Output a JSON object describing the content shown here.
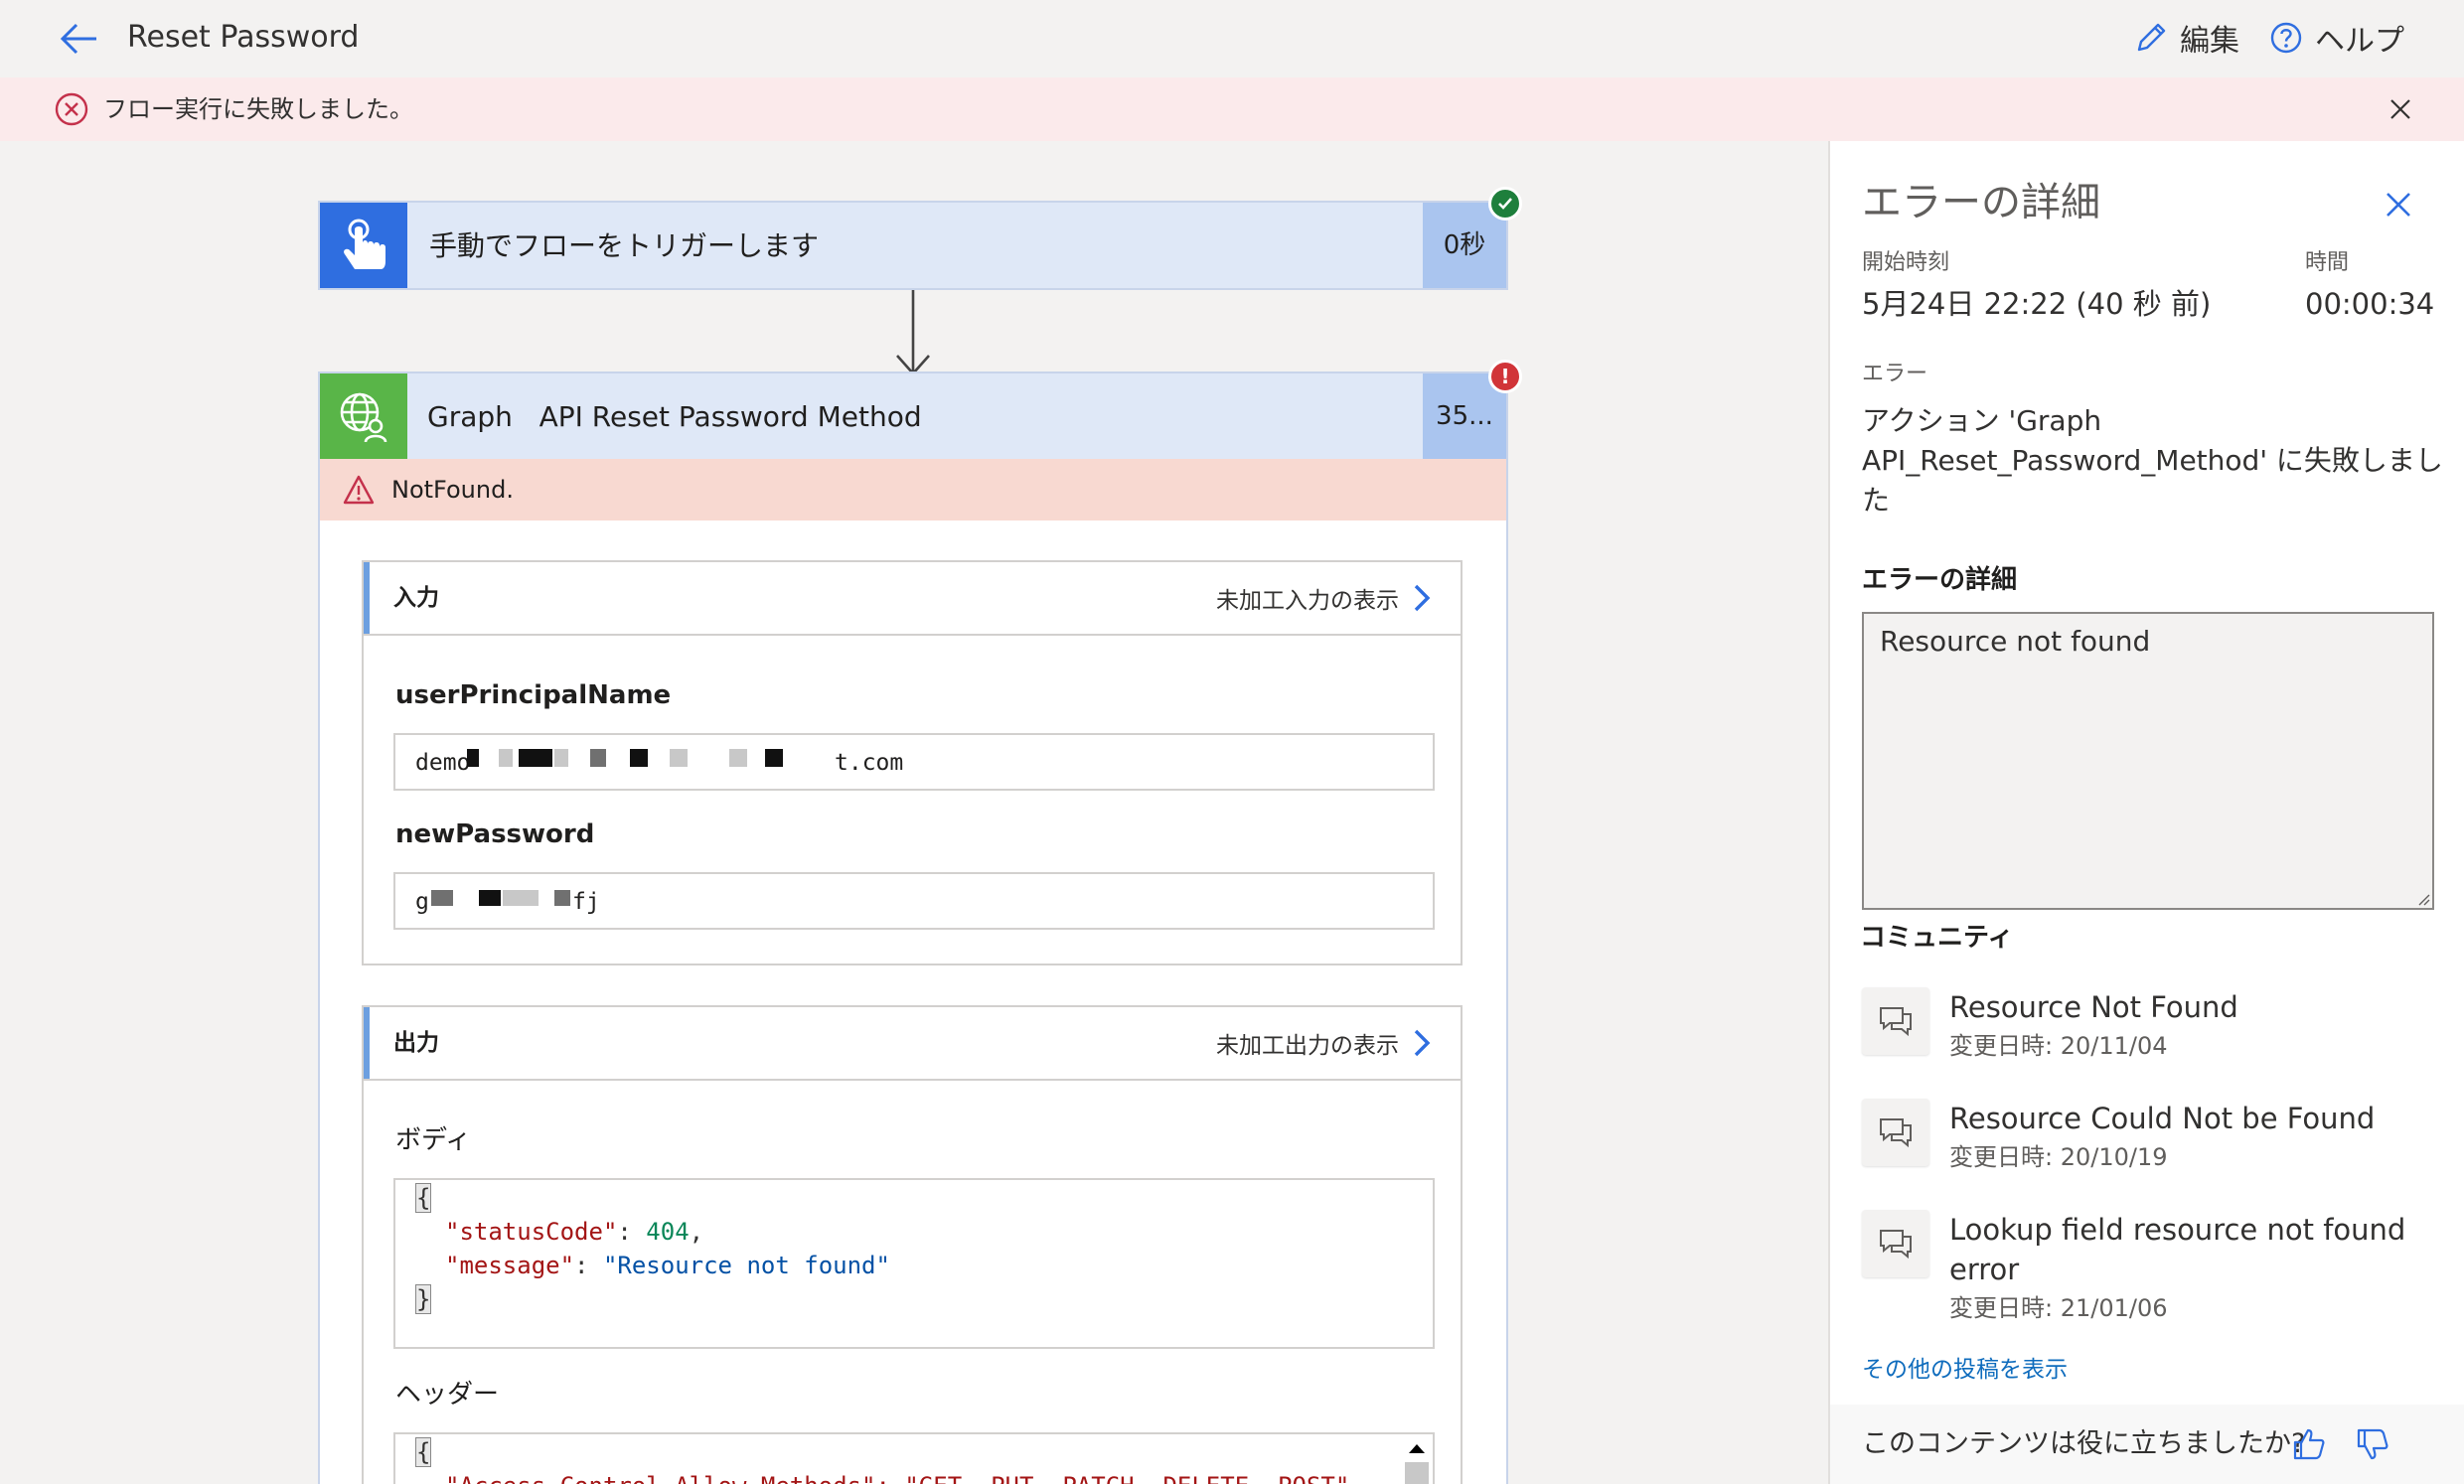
{
  "header": {
    "title": "Reset Password",
    "edit_label": "編集",
    "help_label": "ヘルプ"
  },
  "banner": {
    "message": "フロー実行に失敗しました。"
  },
  "trigger": {
    "title": "手動でフローをトリガーします",
    "duration": "0秒"
  },
  "action": {
    "title": "Graph   API Reset Password Method",
    "duration": "35...",
    "error_text": "NotFound.",
    "input_section": {
      "title": "入力",
      "raw_link": "未加工入力の表示",
      "fields": [
        {
          "label": "userPrincipalName",
          "value_prefix": "demo",
          "value_suffix": "t.com"
        },
        {
          "label": "newPassword",
          "value_prefix": "g",
          "value_suffix": "fj"
        }
      ]
    },
    "output_section": {
      "title": "出力",
      "raw_link": "未加工出力の表示",
      "body_label": "ボディ",
      "body": {
        "open": "{",
        "status_key": "\"statusCode\"",
        "status_val": "404",
        "msg_key": "\"message\"",
        "msg_val": "\"Resource not found\"",
        "close": "}"
      },
      "headers_label": "ヘッダー",
      "headers_open": "{",
      "headers_first_line": "\"Access-Control-Allow-Methods\": \"GET, PUT, PATCH, DELETE, POST\","
    }
  },
  "panel": {
    "title": "エラーの詳細",
    "start_label": "開始時刻",
    "start_value": "5月24日 22:22 (40 秒 前)",
    "duration_label": "時間",
    "duration_value": "00:00:34",
    "error_label": "エラー",
    "error_message": "アクション 'Graph API_Reset_Password_Method' に失敗しました",
    "details_heading": "エラーの詳細",
    "details_text": "Resource not found",
    "community_heading": "コミュニティ",
    "community_items": [
      {
        "title": "Resource Not Found",
        "date": "変更日時: 20/11/04"
      },
      {
        "title": "Resource Could Not be Found",
        "date": "変更日時: 20/10/19"
      },
      {
        "title": "Lookup field resource not found error",
        "date": "変更日時: 21/01/06"
      }
    ],
    "more_posts": "その他の投稿を表示",
    "feedback_question": "このコンテンツは役に立ちましたか?"
  },
  "colors": {
    "accent": "#2f6ee0",
    "success": "#1e7f3c",
    "error": "#d13438",
    "banner_bg": "#fbeaeb",
    "notfound_bg": "#f8d9d1"
  },
  "icons": {
    "back": "arrow-left-icon",
    "edit": "pencil-icon",
    "help": "question-circle-icon",
    "banner": "error-circle-icon",
    "trigger": "touch-hand-icon",
    "action": "globe-user-icon"
  }
}
